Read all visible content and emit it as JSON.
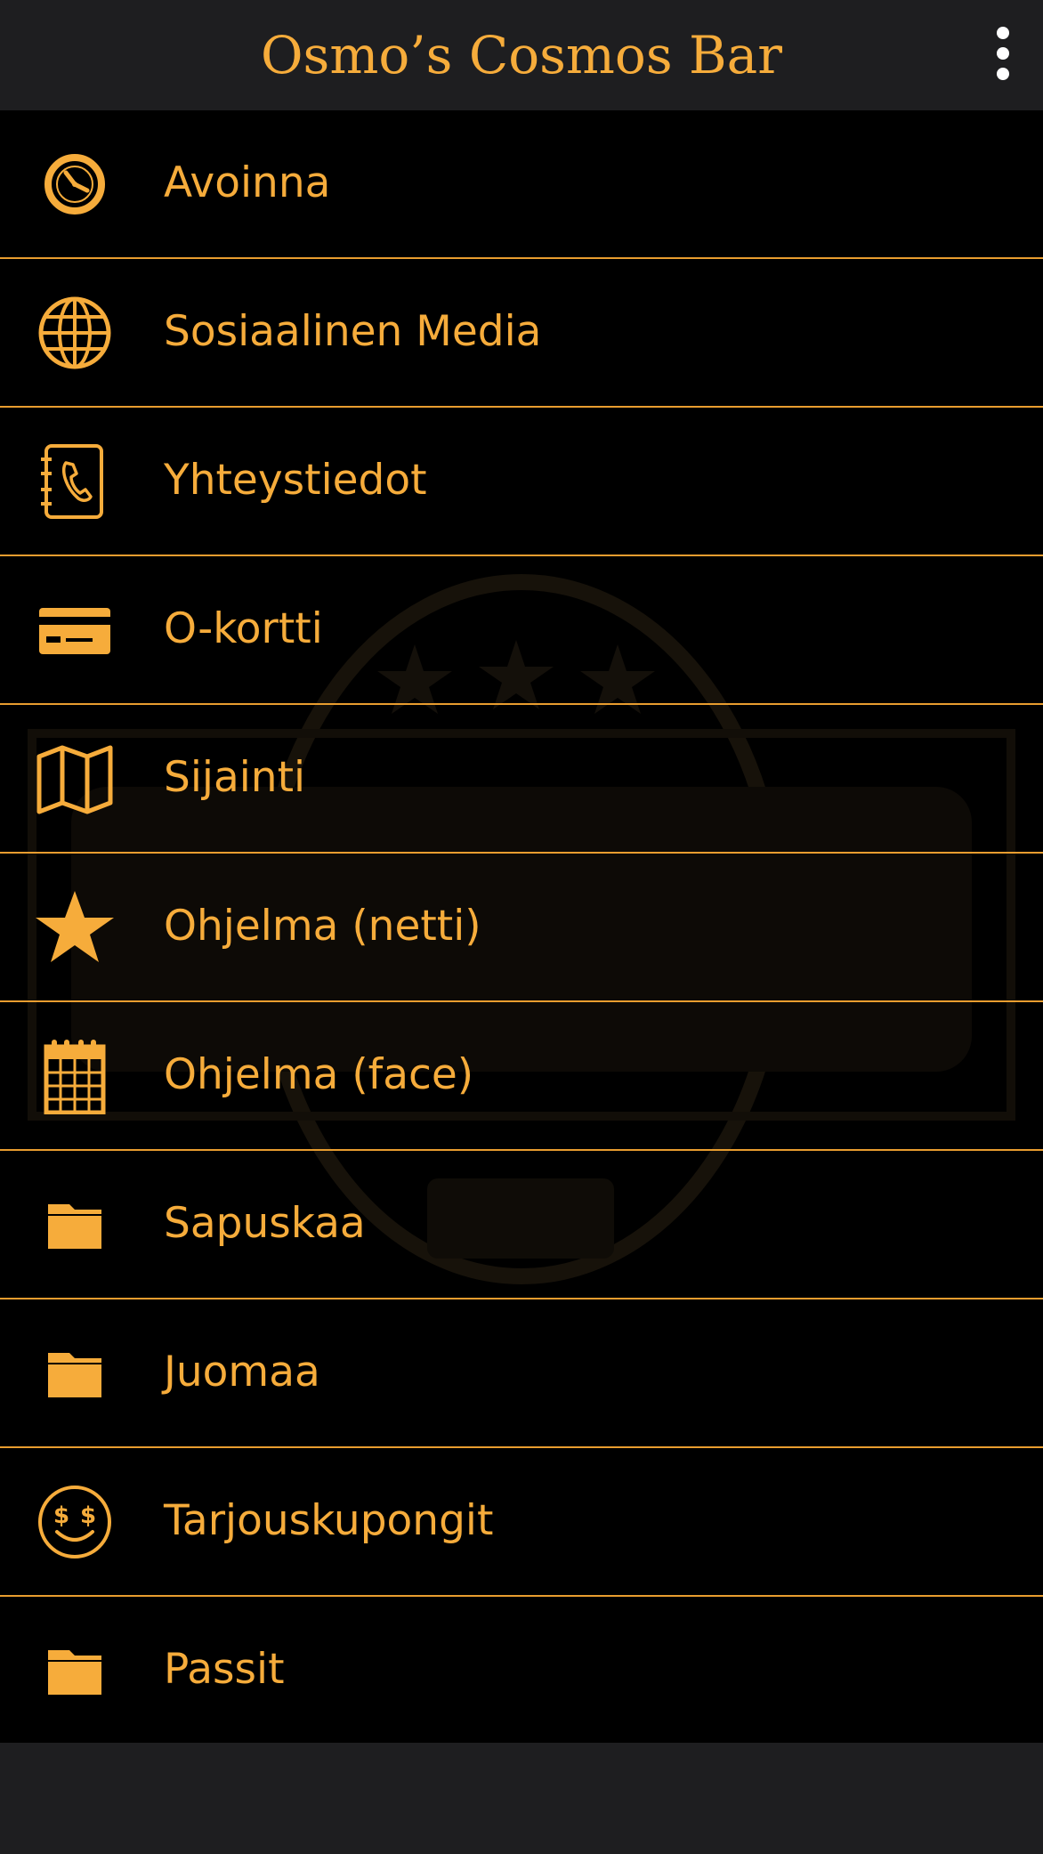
{
  "app": {
    "title": "Osmo’s Cosmos Bar",
    "accent_color": "#f6ac3b",
    "divider_color": "#e89d2f",
    "header_bg": "#1e1e20",
    "list_bg": "#000000"
  },
  "header": {
    "menu_icon": "more-vertical-icon"
  },
  "menu": {
    "items": [
      {
        "label": "Avoinna",
        "icon": "clock-icon"
      },
      {
        "label": "Sosiaalinen Media",
        "icon": "globe-icon"
      },
      {
        "label": "Yhteystiedot",
        "icon": "address-book-icon"
      },
      {
        "label": "O-kortti",
        "icon": "credit-card-icon"
      },
      {
        "label": "Sijainti",
        "icon": "map-icon"
      },
      {
        "label": "Ohjelma (netti)",
        "icon": "star-icon"
      },
      {
        "label": "Ohjelma (face)",
        "icon": "calendar-icon"
      },
      {
        "label": "Sapuskaa",
        "icon": "folder-icon"
      },
      {
        "label": "Juomaa",
        "icon": "folder-icon"
      },
      {
        "label": "Tarjouskupongit",
        "icon": "money-smile-icon"
      },
      {
        "label": "Passit",
        "icon": "folder-icon"
      }
    ]
  }
}
